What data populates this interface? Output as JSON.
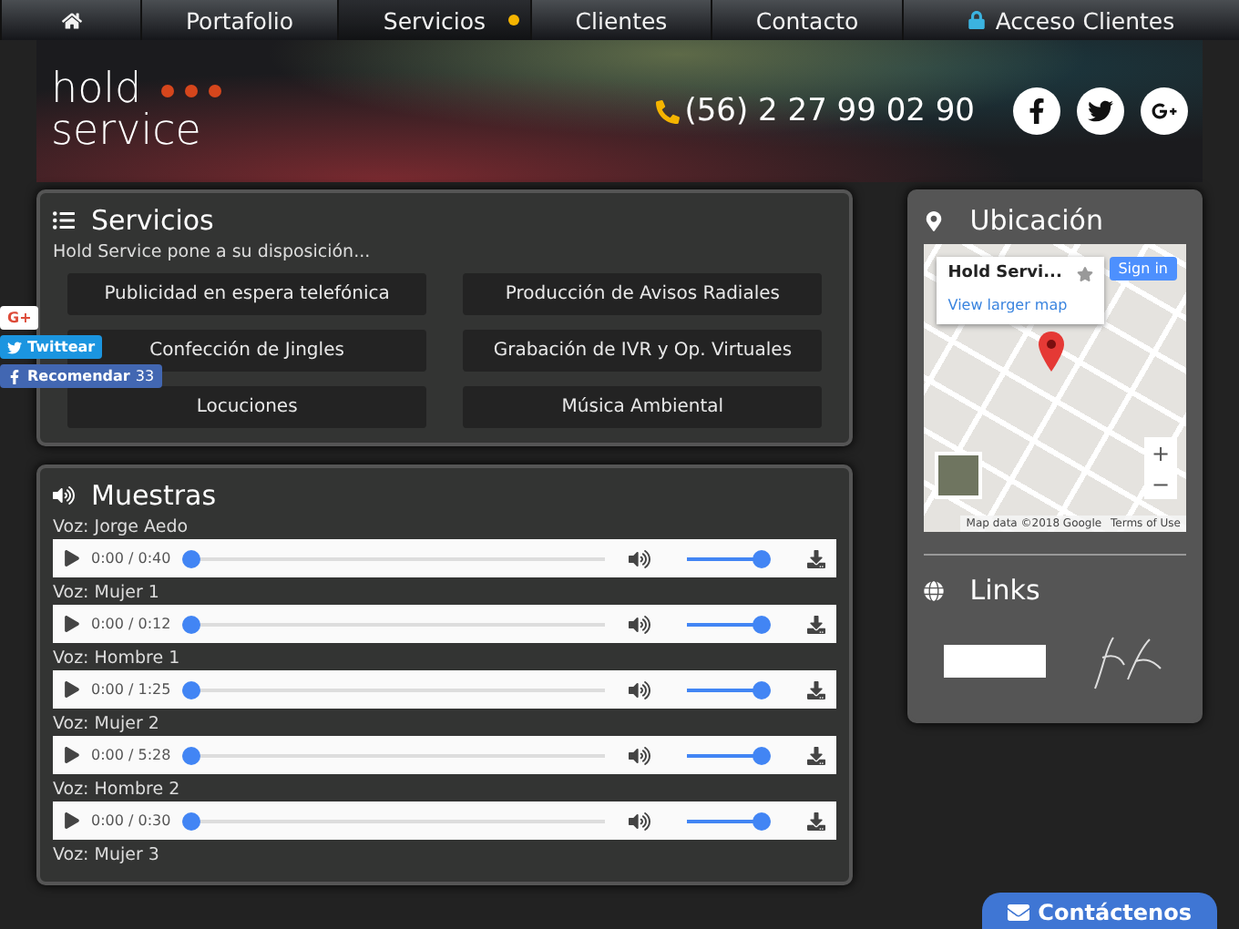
{
  "nav": {
    "items": [
      {
        "kind": "home",
        "selected": false
      },
      {
        "kind": "text",
        "label": "Portafolio",
        "selected": false
      },
      {
        "kind": "text",
        "label": "Servicios",
        "selected": true
      },
      {
        "kind": "text",
        "label": "Clientes",
        "selected": false
      },
      {
        "kind": "text",
        "label": "Contacto",
        "selected": false
      },
      {
        "kind": "lock",
        "label": "Acceso Clientes",
        "selected": false
      }
    ]
  },
  "header": {
    "logo_top": "hold",
    "logo_bottom": "service",
    "phone": "(56) 2 27 99 02 90"
  },
  "services": {
    "title": "Servicios",
    "intro": "Hold Service pone a su disposición...",
    "items": [
      "Publicidad en espera telefónica",
      "Producción de Avisos Radiales",
      "Confección de Jingles",
      "Grabación de IVR y Op. Virtuales",
      "Locuciones",
      "Música Ambiental"
    ]
  },
  "samples": {
    "title": "Muestras",
    "tracks": [
      {
        "label": "Voz: Jorge Aedo",
        "time": "0:00 / 0:40",
        "level": 0,
        "volume": {
          "level": 1
        }
      },
      {
        "label": "Voz: Mujer 1",
        "time": "0:00 / 0:12",
        "level": 0,
        "volume": {
          "level": 1
        }
      },
      {
        "label": "Voz: Hombre 1",
        "time": "0:00 / 1:25",
        "level": 0,
        "volume": {
          "level": 1
        }
      },
      {
        "label": "Voz: Mujer 2",
        "time": "0:00 / 5:28",
        "level": 0,
        "volume": {
          "level": 1
        }
      },
      {
        "label": "Voz: Hombre 2",
        "time": "0:00 / 0:30",
        "level": 0,
        "volume": {
          "level": 1
        }
      },
      {
        "label": "Voz: Mujer 3"
      }
    ]
  },
  "share": {
    "gplus": "G+",
    "twitter": "Twittear",
    "facebook": "Recomendar",
    "facebook_count": "33"
  },
  "location": {
    "title": "Ubicación",
    "place_name": "Hold Servi...",
    "larger_map": "View larger map",
    "sign_in": "Sign in",
    "zoom_in": "+",
    "zoom_out": "−",
    "attribution": "Map data ©2018 Google",
    "terms": "Terms of Use"
  },
  "links": {
    "title": "Links"
  },
  "contact_button": "Contáctenos"
}
